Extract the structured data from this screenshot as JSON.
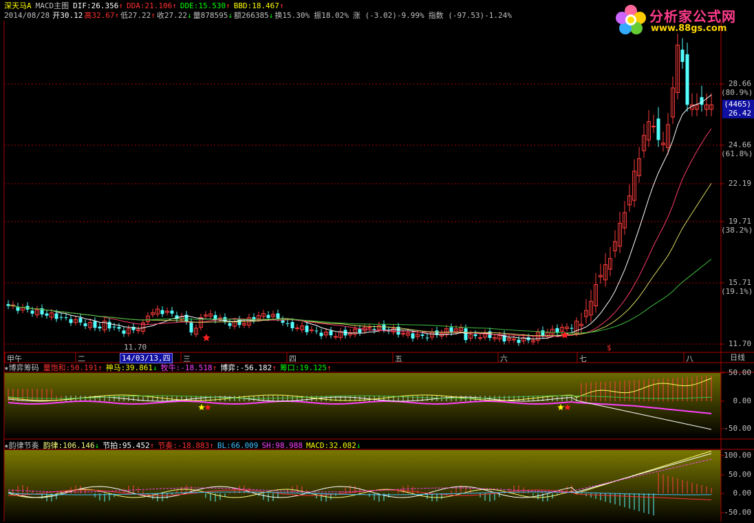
{
  "main_panel": {
    "stock_name": "深天马A",
    "indicator_name": "MACD主图",
    "indicators": [
      {
        "label": "DIF:26.356",
        "arrow": "↑",
        "color": "#ffffff"
      },
      {
        "label": "DDA:21.106",
        "arrow": "↑",
        "color": "#ff3030"
      },
      {
        "label": "DDE:15.530",
        "arrow": "↑",
        "color": "#00ff00"
      },
      {
        "label": "BBD:18.467",
        "arrow": "↑",
        "color": "#ffff00"
      }
    ],
    "quote": {
      "date": "2014/08/28",
      "open": "开30.12",
      "high": "高32.67",
      "low": "低27.22",
      "close": "收27.22",
      "volume": "量878595",
      "amount": "额266385",
      "turnover": "换15.30%",
      "amplitude": "振18.02%",
      "change": "涨 (-3.02)-9.99%",
      "index": "指数 (-97.53)-1.24%"
    },
    "y_ticks": [
      {
        "label": "28.66",
        "pct": "(80.9%)"
      },
      {
        "label": "24.66",
        "pct": "(61.8%)"
      },
      {
        "label": "22.19",
        "pct": ""
      },
      {
        "label": "19.71",
        "pct": "(38.2%)"
      },
      {
        "label": "15.71",
        "pct": "(19.1%)"
      },
      {
        "label": "11.70",
        "pct": ""
      }
    ],
    "highlight_box": {
      "top": "(4465)",
      "bottom": "26.42"
    },
    "min_marker": "11.70",
    "month_labels": [
      "甲午",
      "二",
      "三",
      "四",
      "五",
      "六",
      "七",
      "八"
    ],
    "date_tag": "14/03/13,四",
    "period": "日线"
  },
  "panel2": {
    "title": "★博弈筹码",
    "values": [
      {
        "label": "量饱和:50.191",
        "arrow": "↑",
        "color": "#ff3030"
      },
      {
        "label": "神马:39.861",
        "arrow": "↓",
        "color": "#ffff00"
      },
      {
        "label": "牧牛:-18.518",
        "arrow": "↑",
        "color": "#ff40ff"
      },
      {
        "label": "博弈:-56.182",
        "arrow": "↑",
        "color": "#ffffff"
      },
      {
        "label": "筹口:19.125",
        "arrow": "↑",
        "color": "#00ff00"
      }
    ],
    "y_ticks": [
      "50.00",
      "0.00",
      "-50.00"
    ]
  },
  "panel3": {
    "title": "★韵律节奏",
    "values": [
      {
        "label": "韵律:106.146",
        "arrow": "↓",
        "color": "#ffff80"
      },
      {
        "label": "节拍:95.452",
        "arrow": "↑",
        "color": "#ffffff"
      },
      {
        "label": "节奏:-18.883",
        "arrow": "↑",
        "color": "#ff3030"
      },
      {
        "label": "BL:66.009",
        "arrow": "",
        "color": "#40c0ff"
      },
      {
        "label": "SH:98.988",
        "arrow": "",
        "color": "#ff40ff"
      },
      {
        "label": "MACD:32.082",
        "arrow": "↓",
        "color": "#ffff00"
      }
    ],
    "y_ticks": [
      "100.00",
      "50.00",
      "0.00",
      "-50.00"
    ]
  },
  "logo": {
    "title": "分析家公式网",
    "url": "www.88gs.com"
  },
  "colors": {
    "up": "#ff3c3c",
    "down": "#54ffff",
    "grid": "#b00000",
    "axis": "#b00000"
  }
}
